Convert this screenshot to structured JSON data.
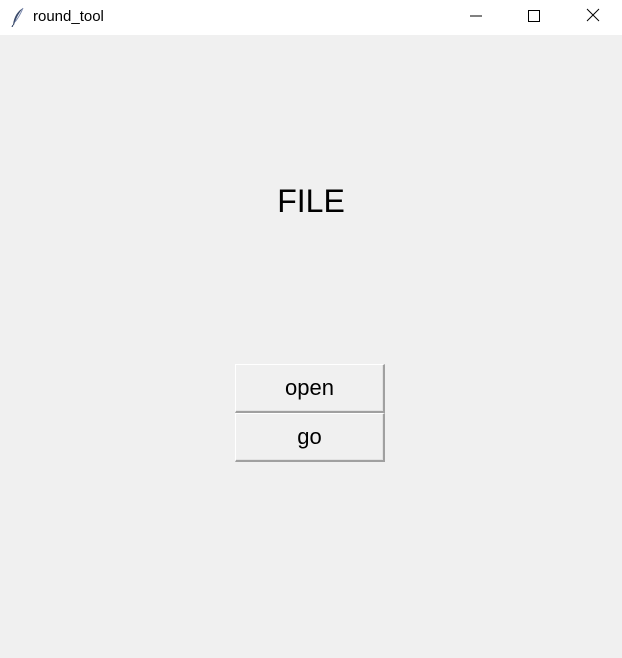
{
  "window": {
    "title": "round_tool",
    "icon": "feather-icon",
    "controls": {
      "minimize_icon": "minimize-icon",
      "maximize_icon": "maximize-icon",
      "close_icon": "close-icon"
    }
  },
  "main": {
    "heading": "FILE",
    "buttons": {
      "open_label": "open",
      "go_label": "go"
    }
  },
  "colors": {
    "background": "#f0f0f0",
    "titlebar": "#ffffff",
    "text": "#000000"
  }
}
